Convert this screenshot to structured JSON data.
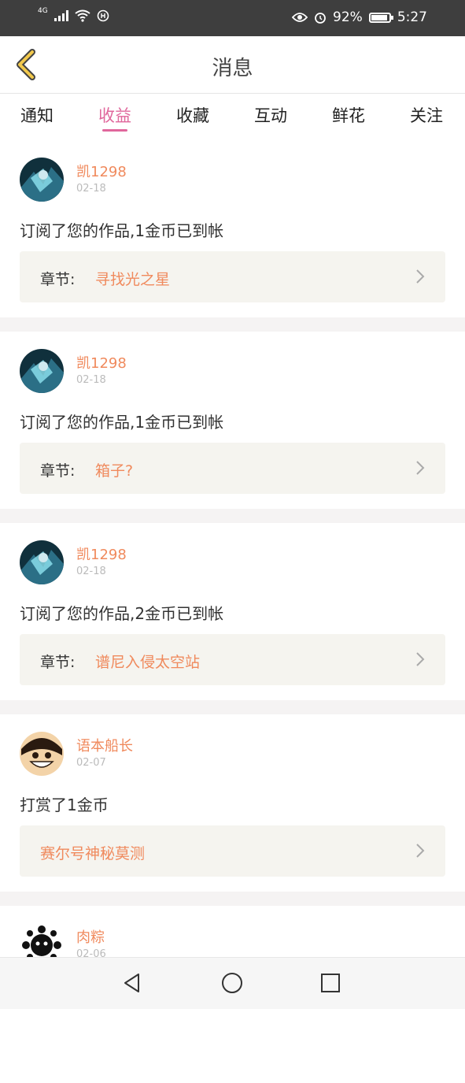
{
  "status": {
    "network": "4G",
    "battery": "92%",
    "battery_level": 0.92,
    "time": "5:27"
  },
  "header": {
    "title": "消息",
    "back_icon": "chevron-left-icon",
    "accent": "#f2c94c"
  },
  "tabs": [
    {
      "label": "通知"
    },
    {
      "label": "收益",
      "active": true
    },
    {
      "label": "收藏"
    },
    {
      "label": "互动"
    },
    {
      "label": "鲜花"
    },
    {
      "label": "关注"
    }
  ],
  "colors": {
    "accent_pink": "#e0679c",
    "accent_orange": "#f08a5d"
  },
  "messages": [
    {
      "username": "凯1298",
      "date": "02-18",
      "text": "订阅了您的作品,1金币已到帐",
      "chapter_label": "章节:",
      "chapter_name": "寻找光之星"
    },
    {
      "username": "凯1298",
      "date": "02-18",
      "text": "订阅了您的作品,1金币已到帐",
      "chapter_label": "章节:",
      "chapter_name": "箱子?"
    },
    {
      "username": "凯1298",
      "date": "02-18",
      "text": "订阅了您的作品,2金币已到帐",
      "chapter_label": "章节:",
      "chapter_name": "谱尼入侵太空站"
    },
    {
      "username": "语本船长",
      "date": "02-07",
      "text": "打赏了1金币",
      "chapter_label": "",
      "chapter_name": "赛尔号神秘莫测"
    },
    {
      "username": "肉粽",
      "date": "02-06",
      "text": "",
      "chapter_label": "",
      "chapter_name": ""
    }
  ],
  "navbar": {
    "back": "triangle-back-icon",
    "home": "circle-home-icon",
    "recents": "square-recents-icon"
  }
}
